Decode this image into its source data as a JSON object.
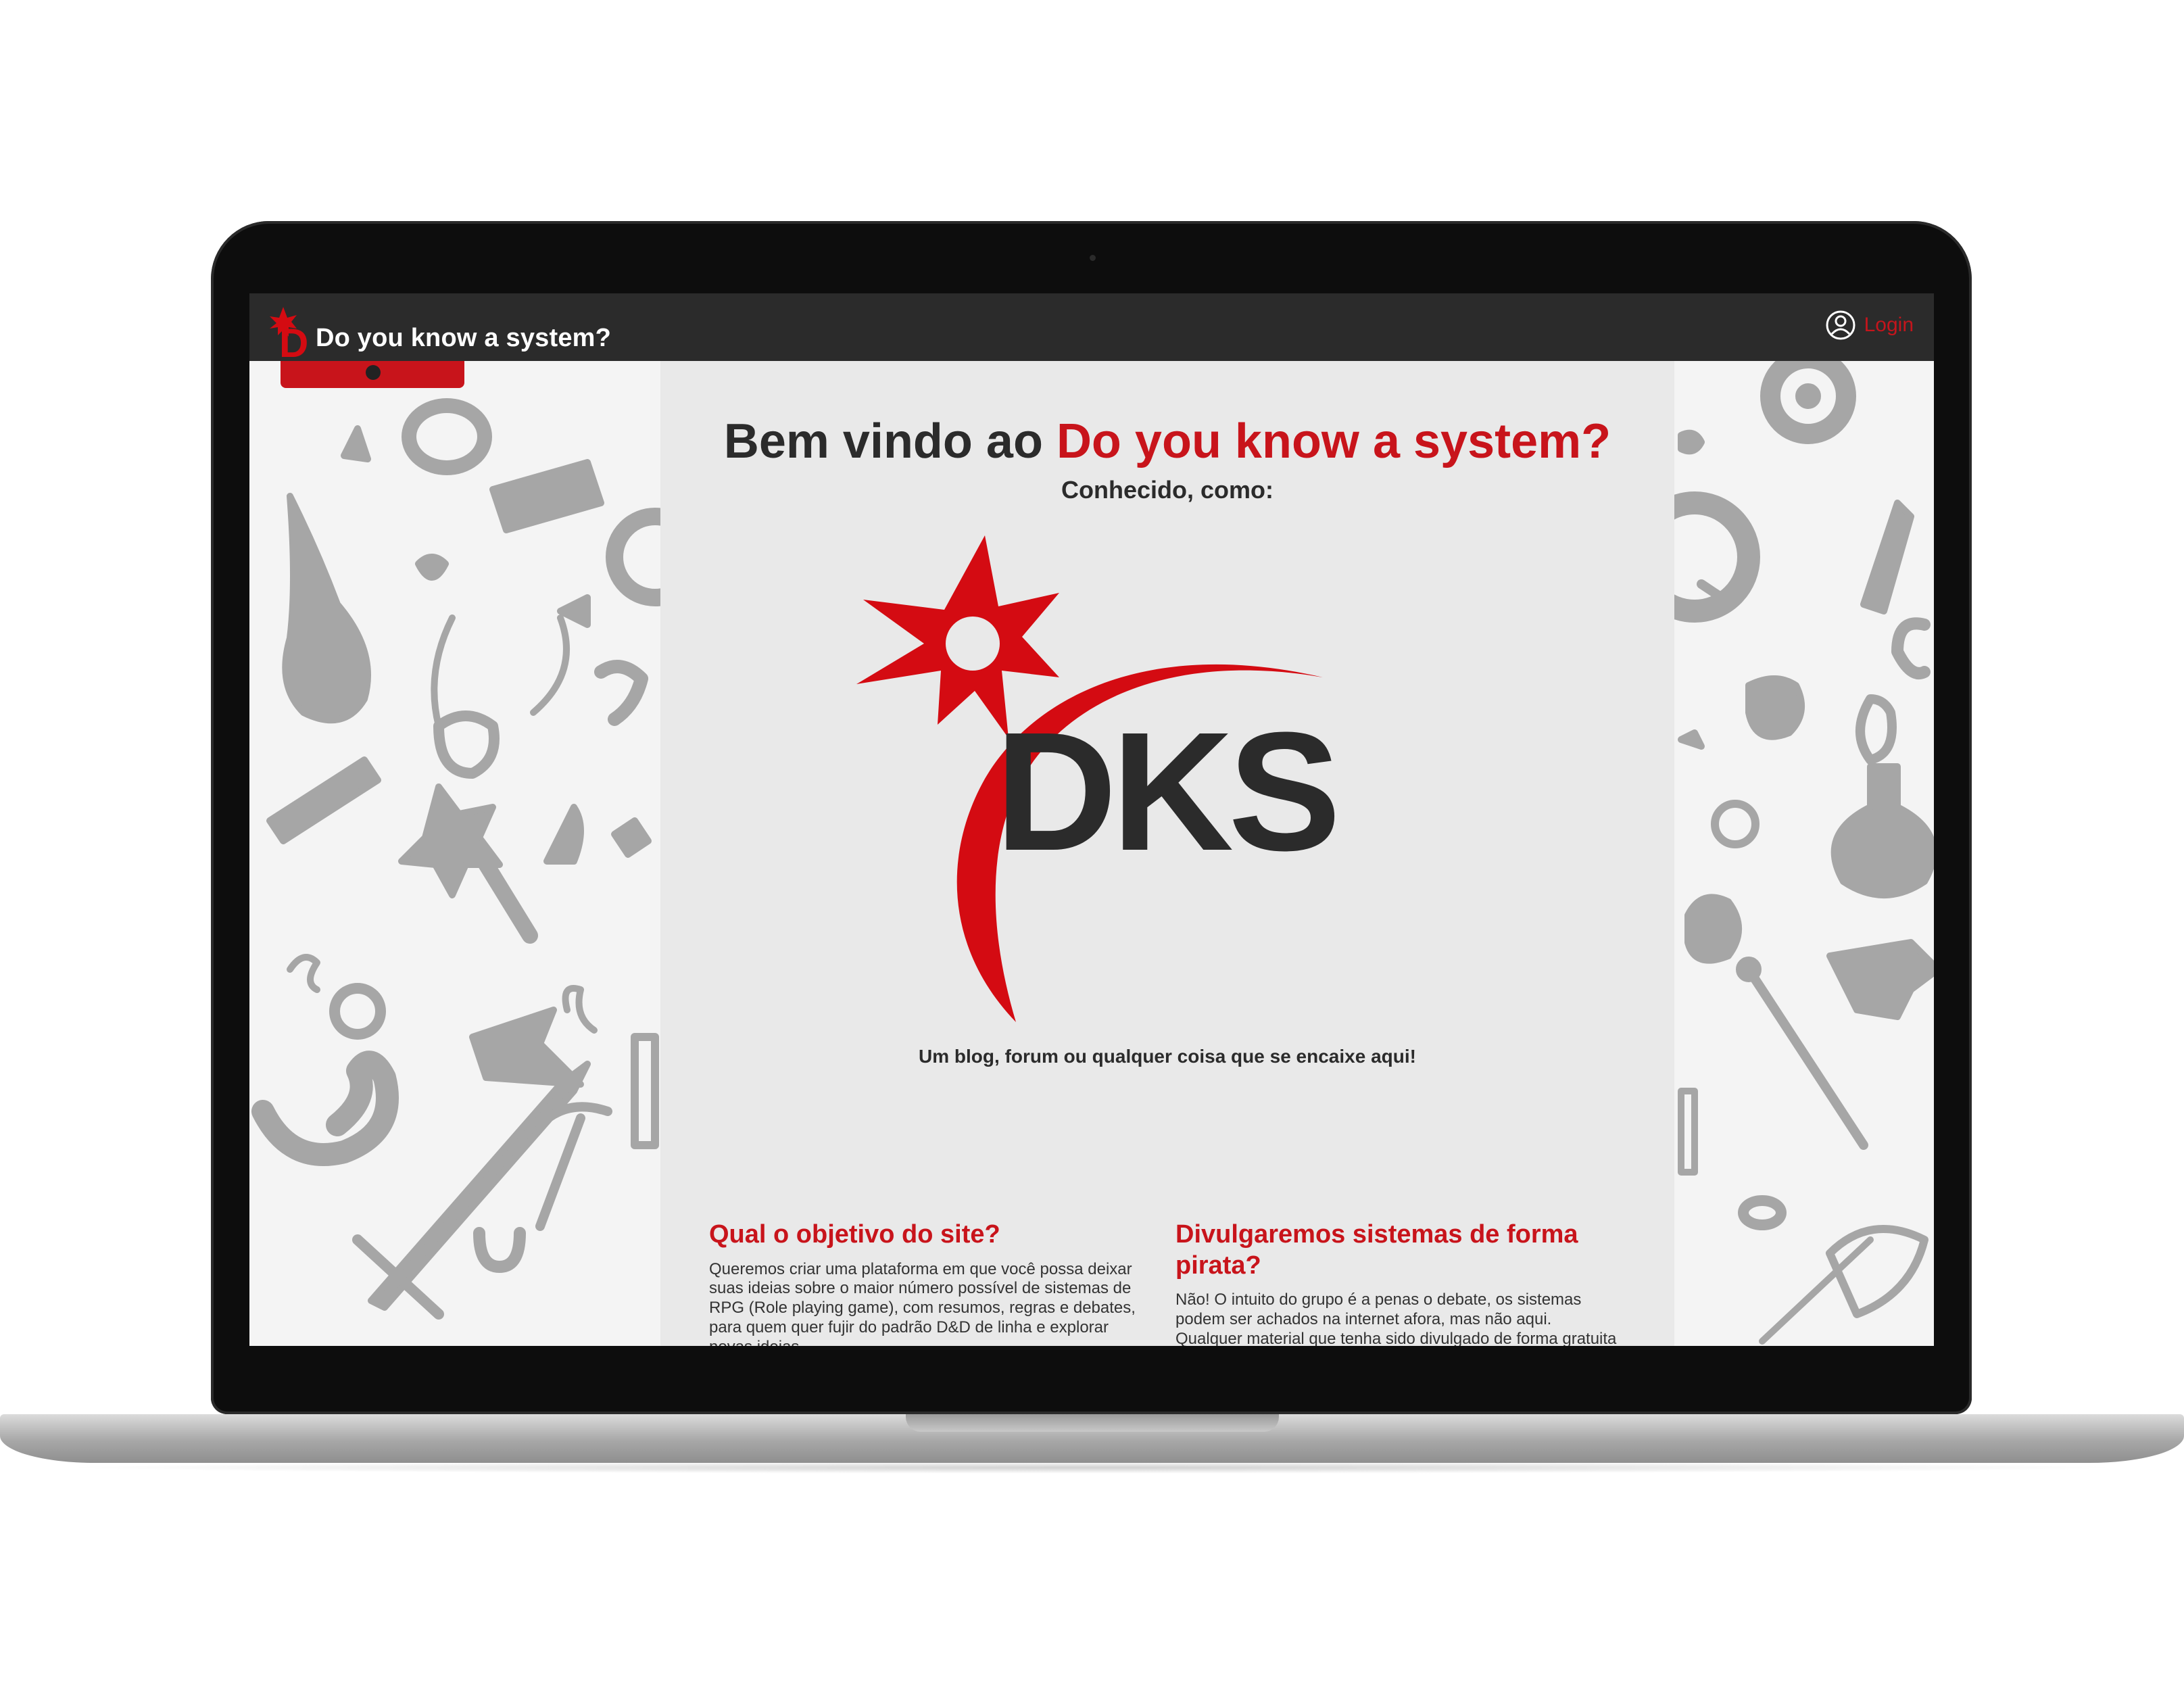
{
  "app": {
    "brand": "Do you know a system?",
    "login_label": "Login"
  },
  "hero": {
    "welcome_prefix": "Bem vindo ao ",
    "welcome_accent": "Do you know a system?",
    "known_as": "Conhecido, como:",
    "logo_text": "DKS",
    "tagline": "Um blog, forum ou qualquer coisa que se encaixe aqui!"
  },
  "sections": [
    {
      "title": "Qual o objetivo do site?",
      "body": "Queremos criar uma plataforma em que você possa deixar suas ideias sobre o maior número possível de sistemas de RPG (Role playing game), com resumos, regras e debates, para quem quer fujir do padrão D&D de linha e explorar novas ideias."
    },
    {
      "title": "Divulgaremos sistemas de forma pirata?",
      "body": "Não! O intuito do grupo é a penas o debate, os sistemas podem ser achados na internet afora, mas não aqui. Qualquer material que tenha sido divulgado de forma gratuita ou caso um mestre escritor queira divulgar seu sistema próprio, sera permitido, com os links apropriados. A equipe do DKS não se responsabiliza com links"
    }
  ],
  "colors": {
    "accent": "#c8141b",
    "header": "#2b2b2b",
    "content_bg": "#e9e9e9",
    "doodle": "#a6a6a6"
  },
  "icons": [
    "user-circle-icon",
    "brand-logo-icon"
  ]
}
